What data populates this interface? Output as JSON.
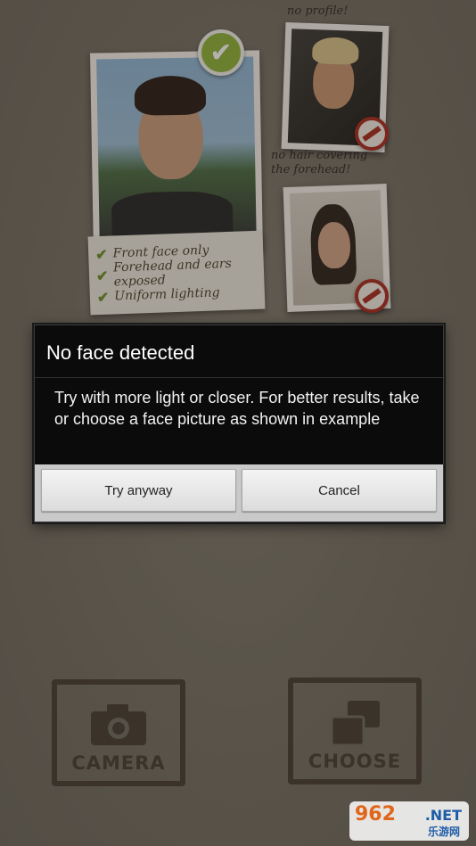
{
  "example": {
    "annotation_profile": "no profile!",
    "annotation_hair": "no hair covering the forehead!",
    "checklist": [
      "Front face only",
      "Forehead and ears exposed",
      "Uniform lighting"
    ]
  },
  "dialog": {
    "title": "No face detected",
    "message": "Try with more light or closer. For better results, take or choose a face picture as shown in example",
    "try_anyway": "Try anyway",
    "cancel": "Cancel"
  },
  "actions": {
    "camera_label": "CAMERA",
    "choose_label": "CHOOSE"
  },
  "watermark": {
    "main": "962",
    "suffix": ".NET",
    "cn": "乐游网"
  },
  "colors": {
    "background": "#726c61",
    "dialog_bg": "#0b0b0b",
    "button_bar": "#c9c9c9",
    "check_green": "#8fb23a",
    "no_sign_red": "#a92a20"
  }
}
